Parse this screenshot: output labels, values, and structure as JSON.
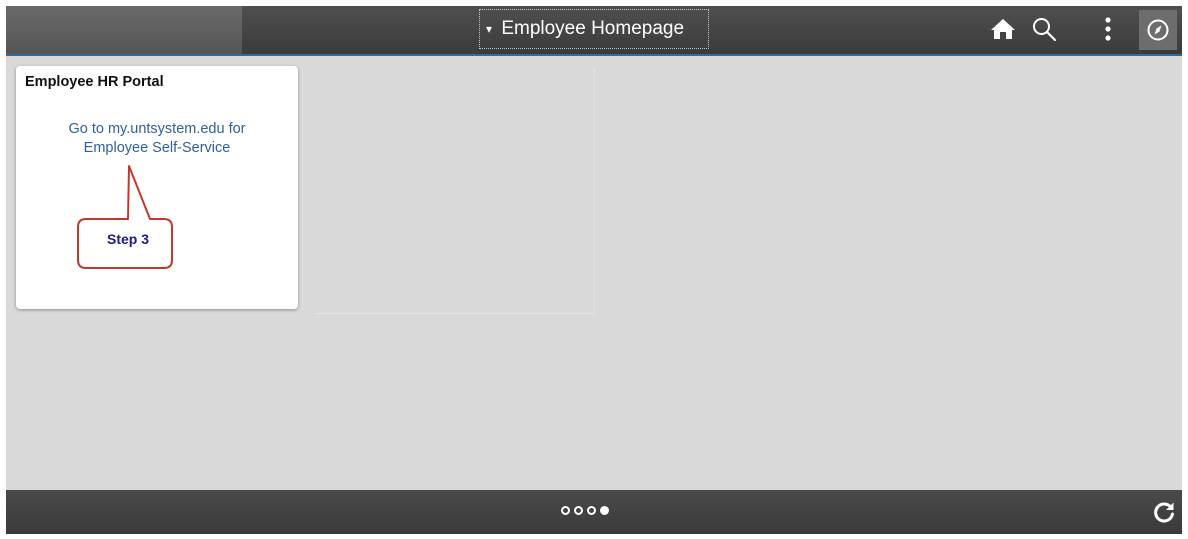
{
  "header": {
    "title": "Employee Homepage",
    "title_arrow": "▾",
    "icons": {
      "home": "home-icon",
      "search": "search-icon",
      "actions": "more-vertical-icon",
      "navbar": "compass-icon"
    }
  },
  "tile": {
    "title": "Employee HR Portal",
    "link_line1": "Go to my.untsystem.edu for",
    "link_line2": "Employee Self-Service"
  },
  "callout": {
    "label": "Step 3",
    "border_color": "#c0392b"
  },
  "footer": {
    "pages": [
      {
        "active": false
      },
      {
        "active": false
      },
      {
        "active": false
      },
      {
        "active": true
      }
    ],
    "refresh_icon": "refresh-icon"
  },
  "colors": {
    "background": "#d9d9d9",
    "header": "#444444",
    "accent": "#2e6da4",
    "link": "#2f5f9e"
  }
}
